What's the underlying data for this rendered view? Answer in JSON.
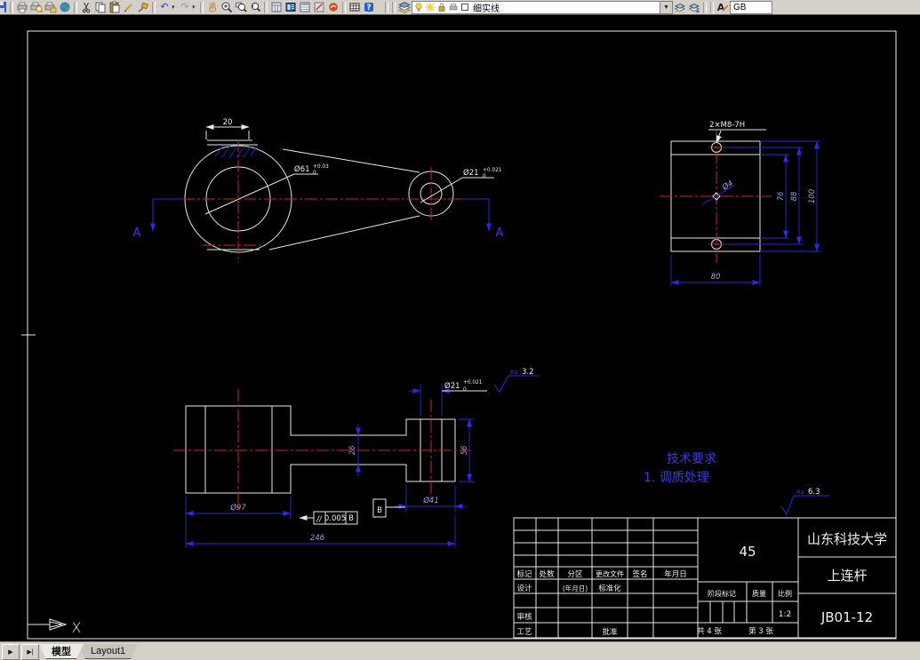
{
  "toolbar": {
    "layer_combo_value": "细实线",
    "style_combo_value": "GB",
    "icons": [
      "save-icon",
      "plot-icon",
      "plot-preview-icon",
      "publish-icon",
      "web-publish-icon",
      "cut-icon",
      "copy-icon",
      "paste-icon",
      "match-properties-icon",
      "modify-icon",
      "undo-icon",
      "redo-icon",
      "pan-icon",
      "zoom-realtime-icon",
      "zoom-window-icon",
      "zoom-previous-icon",
      "calculator-icon",
      "palette-icon",
      "sheet-set-icon",
      "markup-icon",
      "standards-icon",
      "table-icon",
      "help-icon",
      "layers-icon",
      "layer-on-icon",
      "layer-freeze-icon",
      "layer-lock-icon",
      "layer-plot-icon",
      "layer-color-swatch",
      "layer-previous-icon",
      "layer-states-icon",
      "text-style-icon"
    ]
  },
  "drawing": {
    "front_view": {
      "dim_keyway": "20",
      "section_label_left": "A",
      "section_label_right": "A",
      "dim_bore": {
        "value": "Ø61",
        "tol_upper": "+0.03",
        "tol_lower": "0"
      },
      "dim_small_bore": {
        "value": "Ø21",
        "tol_upper": "+0.021",
        "tol_lower": "0"
      }
    },
    "side_view": {
      "thread_label": "2×M8-7H",
      "dim_center_hole": "Ø4",
      "dim_inner": "76",
      "dim_holes": "88",
      "dim_height": "100",
      "dim_width": "80"
    },
    "section_view": {
      "dim_big_od": "Ø97",
      "dim_length": "246",
      "dim_small_od": "Ø41",
      "dim_neck": "26",
      "dim_small_width": "56",
      "dim_bore": {
        "value": "Ø21",
        "tol_upper": "+0.021",
        "tol_lower": "0"
      },
      "roughness": {
        "label": "Ra",
        "value": "3.2"
      },
      "fcf": {
        "symbol": "//",
        "tolerance": "0.005",
        "datum": "B"
      },
      "datum_label": "B"
    },
    "notes": {
      "tech_title": "技术要求",
      "tech_item1": "1. 调质处理",
      "roughness_general": {
        "label": "Ra",
        "value": "6.3"
      }
    },
    "ucs_label": "X"
  },
  "title_block": {
    "rev_labels": [
      "标记",
      "处数",
      "分区",
      "更改文件",
      "签名",
      "年月日"
    ],
    "design": "设计",
    "date_note": "(年月日)",
    "standardization": "标准化",
    "check": "审核",
    "craft": "工艺",
    "approve": "批准",
    "stage_label": "阶段标记",
    "quality_label": "质量",
    "ratio_label": "比例",
    "scale_value": "1:2",
    "material": "45",
    "organization": "山东科技大学",
    "part_name": "上连杆",
    "drawing_no": "JB01-12",
    "sheet_total": "共 4 张",
    "sheet_no": "第 3 张"
  },
  "tabbar": {
    "nav1": "▶",
    "nav2": "▶|",
    "model_tab": "模型",
    "layout_tab": "Layout1"
  }
}
